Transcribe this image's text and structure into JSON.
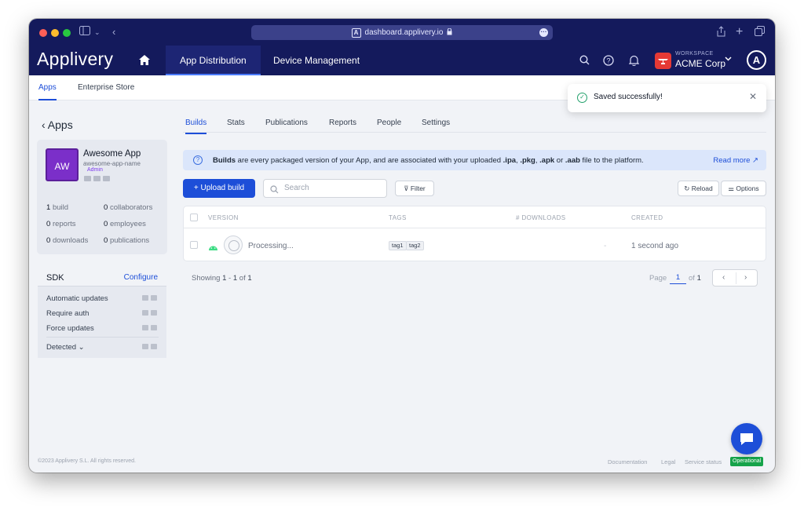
{
  "browser": {
    "url": "dashboard.applivery.io",
    "site_icon": "A"
  },
  "app": {
    "logo": "Applivery",
    "nav_tabs": [
      "App Distribution",
      "Device Management"
    ],
    "workspace_label": "WORKSPACE",
    "workspace_name": "ACME Corp",
    "avatar_letter": "A"
  },
  "subnav": [
    "Apps",
    "Enterprise Store"
  ],
  "toast": {
    "message": "Saved successfully!"
  },
  "sidebar": {
    "back_label": "Apps",
    "app_initials": "AW",
    "app_name": "Awesome App",
    "app_slug": "awesome-app-name",
    "app_role": "Admin",
    "stats": [
      {
        "num": "1",
        "label": "build"
      },
      {
        "num": "0",
        "label": "collaborators"
      },
      {
        "num": "0",
        "label": "reports"
      },
      {
        "num": "0",
        "label": "employees"
      },
      {
        "num": "0",
        "label": "downloads"
      },
      {
        "num": "0",
        "label": "publications"
      }
    ],
    "sdk": {
      "title": "SDK",
      "configure": "Configure",
      "rows": [
        "Automatic updates",
        "Require auth",
        "Force updates"
      ],
      "detected": "Detected"
    },
    "footer": "©2023 Applivery S.L. All rights reserved."
  },
  "main": {
    "tabs": [
      "Builds",
      "Stats",
      "Publications",
      "Reports",
      "People",
      "Settings"
    ],
    "info": {
      "bold": "Builds",
      "text": " are every packaged version of your App, and are associated with your uploaded ",
      "ext1": ".ipa",
      "sep1": ", ",
      "ext2": ".pkg",
      "sep2": ", ",
      "ext3": ".apk",
      "sep3": " or ",
      "ext4": ".aab",
      "tail": " file to the platform.",
      "read_more": "Read more"
    },
    "upload_label": "+ Upload build",
    "search_placeholder": "Search",
    "filter_label": "Filter",
    "reload_label": "Reload",
    "options_label": "Options",
    "table": {
      "headers": [
        "VERSION",
        "TAGS",
        "# DOWNLOADS",
        "CREATED"
      ],
      "rows": [
        {
          "version": "Processing...",
          "tags": [
            "tag1",
            "tag2"
          ],
          "downloads": "-",
          "created": "1 second ago"
        }
      ]
    },
    "showing": {
      "prefix": "Showing ",
      "from": "1",
      "dash": " - ",
      "to": "1",
      "of": " of ",
      "total": "1"
    },
    "pager": {
      "page_label": "Page",
      "page": "1",
      "of_label": "of",
      "total": "1"
    }
  },
  "footer": {
    "links": [
      "Documentation",
      "Legal",
      "Service status"
    ],
    "status": "Operational"
  },
  "colors": {
    "nav_bg": "#141a5c",
    "accent": "#1d4ed8",
    "app_avatar": "#7b2fc9",
    "success": "#16a34a",
    "workspace_badge": "#e53935"
  }
}
